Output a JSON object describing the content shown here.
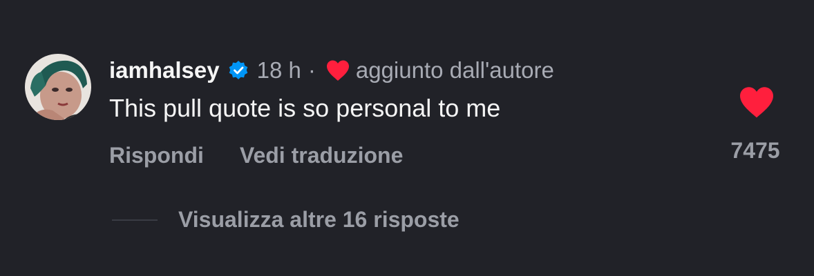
{
  "comment": {
    "username": "iamhalsey",
    "verified_icon": "verified-badge-icon",
    "timestamp": "18 h",
    "separator": "·",
    "author_liked_icon": "heart-icon",
    "author_liked_label": "aggiunto dall'autore",
    "text": "This pull quote is so personal to me",
    "actions": {
      "reply_label": "Rispondi",
      "translate_label": "Vedi traduzione"
    },
    "like_icon": "heart-filled-icon",
    "like_count": "7475",
    "view_replies_label": "Visualizza altre 16 risposte"
  },
  "colors": {
    "background": "#212228",
    "primary_text": "#f5f5f5",
    "secondary_text": "#a8abb4",
    "action_text": "#9b9ea6",
    "heart_red": "#ff1f3d",
    "verified_blue": "#0095f6"
  }
}
